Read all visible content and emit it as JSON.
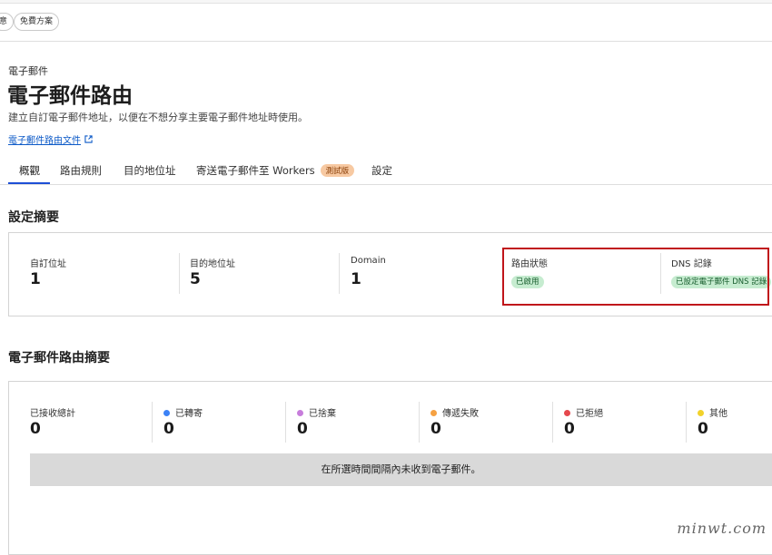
{
  "top": {
    "chip_left": "意",
    "chip_free": "免費方案"
  },
  "header": {
    "overline": "電子郵件",
    "title": "電子郵件路由",
    "description": "建立自訂電子郵件地址，以便在不想分享主要電子郵件地址時使用。",
    "doc_link": "電子郵件路由文件"
  },
  "tabs": [
    {
      "label": "概觀",
      "active": true
    },
    {
      "label": "路由規則"
    },
    {
      "label": "目的地位址"
    },
    {
      "label": "寄送電子郵件至 Workers",
      "badge": "測試版"
    },
    {
      "label": "設定"
    }
  ],
  "config_summary": {
    "title": "設定摘要",
    "stats": [
      {
        "label": "自訂位址",
        "value": "1"
      },
      {
        "label": "目的地位址",
        "value": "5"
      },
      {
        "label": "Domain",
        "value": "1"
      }
    ],
    "routing_status": {
      "label": "路由狀態",
      "badge": "已啟用"
    },
    "dns_records": {
      "label": "DNS 記錄",
      "badge": "已設定電子郵件 DNS 記錄"
    }
  },
  "routing_summary": {
    "title": "電子郵件路由摘要",
    "stats": [
      {
        "label": "已接收總計",
        "value": "0",
        "dot_color": null
      },
      {
        "label": "已轉寄",
        "value": "0",
        "dot_color": "#3b82f6"
      },
      {
        "label": "已捨棄",
        "value": "0",
        "dot_color": "#c77ddb"
      },
      {
        "label": "傳遞失敗",
        "value": "0",
        "dot_color": "#f5a142"
      },
      {
        "label": "已拒絕",
        "value": "0",
        "dot_color": "#e5484d"
      },
      {
        "label": "其他",
        "value": "0",
        "dot_color": "#f2d22b"
      }
    ],
    "empty_message": "在所選時間間隔內未收到電子郵件。"
  },
  "watermark": "minwt.com"
}
